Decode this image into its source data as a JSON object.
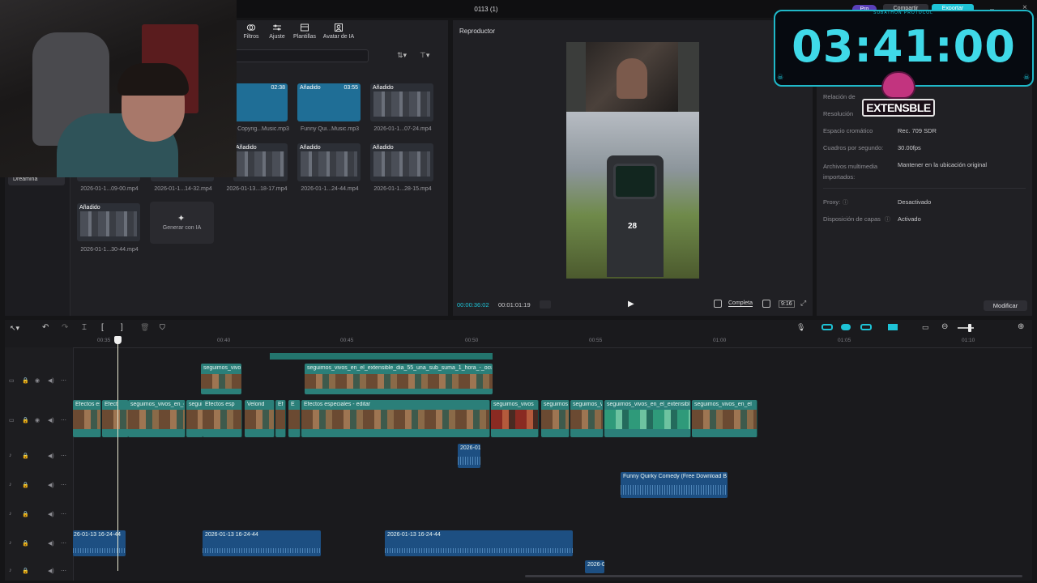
{
  "window": {
    "title": "0113 (1)"
  },
  "top_right": {
    "pro_badge": "Pro",
    "share_button": "Compartir",
    "export_button": "Exportar"
  },
  "media_toolbar": {
    "items": [
      {
        "label": "Filtros",
        "icon": "filters-icon"
      },
      {
        "label": "Ajuste",
        "icon": "adjust-icon"
      },
      {
        "label": "Plantillas",
        "icon": "templates-icon"
      },
      {
        "label": "Avatar de IA",
        "icon": "ai-avatar-icon"
      }
    ]
  },
  "media_sidebar": {
    "item": "Dreamina"
  },
  "media_grid": [
    {
      "label": "Copyrig...Music.mp3",
      "badge": "",
      "duration": "02:38",
      "kind": "audio"
    },
    {
      "label": "Funny Qui...Music.mp3",
      "badge": "Añadido",
      "duration": "03:55",
      "kind": "audio"
    },
    {
      "label": "2026-01-1...07-24.mp4",
      "badge": "Añadido",
      "duration": "",
      "kind": "video"
    },
    {
      "label": "",
      "badge": "Añadido",
      "duration": "",
      "kind": "video"
    },
    {
      "label": "",
      "badge": "Añadido",
      "duration": "",
      "kind": "video"
    },
    {
      "label": "",
      "badge": "Añadido",
      "duration": "",
      "kind": "video"
    },
    {
      "label": "2026-01-1...09-00.mp4",
      "badge": "",
      "duration": "",
      "kind": "video"
    },
    {
      "label": "2026-01-1...14-32.mp4",
      "badge": "",
      "duration": "",
      "kind": "video"
    },
    {
      "label": "2026-01-13...18-17.mp4",
      "badge": "",
      "duration": "",
      "kind": "video"
    },
    {
      "label": "2026-01-1...24-44.mp4",
      "badge": "",
      "duration": "",
      "kind": "video"
    },
    {
      "label": "2026-01-1...28-15.mp4",
      "badge": "",
      "duration": "",
      "kind": "video"
    },
    {
      "label": "2026-01-1...30-44.mp4",
      "badge": "Añadido",
      "duration": "",
      "kind": "video"
    }
  ],
  "generate_ai": {
    "label": "Generar con IA"
  },
  "player": {
    "title": "Reproductor",
    "current_time": "00:00:36:02",
    "total_time": "00:01:01:19",
    "quality_label": "Completa",
    "aspect_label": "9:16",
    "hud_ammo": "28"
  },
  "details": {
    "rows": [
      {
        "label": "Relación de",
        "value": ""
      },
      {
        "label": "Resolución",
        "value": ""
      },
      {
        "label": "Espacio cromático",
        "value": "Rec. 709 SDR"
      },
      {
        "label": "Cuadros por segundo:",
        "value": "30.00fps"
      },
      {
        "label": "Archivos multimedia importados:",
        "value": "Mantener en la ubicación original"
      },
      {
        "label": "Proxy:",
        "value": "Desactivado"
      },
      {
        "label": "Disposición de capas",
        "value": "Activado"
      }
    ],
    "modify_button": "Modificar"
  },
  "overlay": {
    "timer": "03:41:00",
    "subathon_label": "SUBATHON PROTOCOL",
    "brand": "EXTENSBLE"
  },
  "timeline": {
    "ruler": [
      "00:35",
      "00:40",
      "00:45",
      "00:50",
      "00:55",
      "01:00",
      "01:05",
      "01:10"
    ],
    "track2_clips": [
      "seguimos_vivos",
      "seguimos_vivos_en_el_extensible_dia_55_una_sub_suma_1_hora_-_ocupa_el"
    ],
    "main_clips": [
      "Efectos es",
      "Efect",
      "seguimos_vivos_en_el",
      "segui",
      "Efectos esp",
      "Velorid",
      "Ef",
      "E",
      "Efectos especiales - editar",
      "seguimos_vivos_en_el_extensible_dia_55_u",
      "seguimos_vivos",
      "seguimos",
      "seguimos_vi",
      "seguimos_vivos_en_el_extensible",
      "seguimos_vivos_en_el"
    ],
    "audio_small": "2026-01",
    "music_clip": "Funny Quirky Comedy (Free Download Bac",
    "voice_clips": [
      "26-01-13 16-24-44",
      "2026-01-13 16-24-44",
      "2026-01-13 16-24-44"
    ],
    "bottom_clip": "2026-0"
  },
  "colors": {
    "accent": "#1ec3d6",
    "video_clip": "#2b7f79",
    "audio_clip": "#1d4f82",
    "brand_pink": "#d6338f"
  }
}
